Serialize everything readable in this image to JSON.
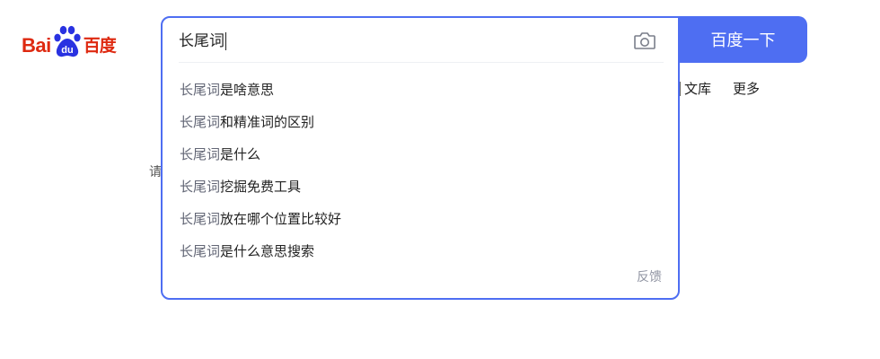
{
  "logo": {
    "text_en": "Bai",
    "text_paw": "du",
    "text_cn": "百度",
    "color": "#de2910"
  },
  "search": {
    "query": "长尾词",
    "camera_icon": "camera-icon",
    "button_label": "百度一下",
    "accent_color": "#4e6ef2"
  },
  "suggestions": [
    {
      "prefix": "长尾词",
      "rest": "是啥意思"
    },
    {
      "prefix": "长尾词",
      "rest": "和精准词的区别"
    },
    {
      "prefix": "长尾词",
      "rest": "是什么"
    },
    {
      "prefix": "长尾词",
      "rest": "挖掘免费工具"
    },
    {
      "prefix": "长尾词",
      "rest": "放在哪个位置比较好"
    },
    {
      "prefix": "长尾词",
      "rest": "是什么意思搜索"
    }
  ],
  "feedback_label": "反馈",
  "nav": {
    "wenku": "文库",
    "more": "更多"
  },
  "hint_fragment": "请"
}
